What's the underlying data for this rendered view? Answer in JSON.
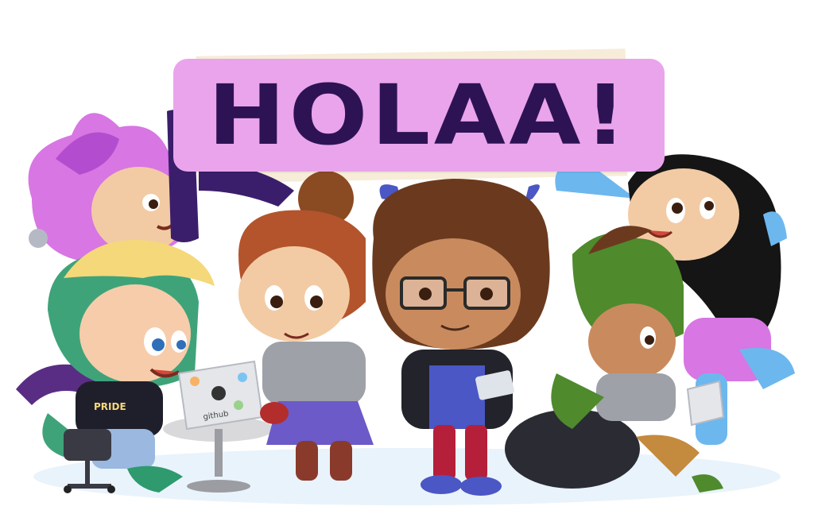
{
  "banner": {
    "text": "HOLAA!",
    "background_color": "#eaa4ec",
    "text_color": "#2e1354"
  },
  "laptop_screen_text": "github",
  "shirt_text": "PRIDE",
  "characters": [
    {
      "name": "purple-haired-octocat",
      "hair_color": "#d876e3"
    },
    {
      "name": "blonde-green-octocat",
      "hair_color": "#f5d87a"
    },
    {
      "name": "bun-haired-octocat",
      "hair_color": "#8a4a22"
    },
    {
      "name": "curly-haired-glasses-octocat",
      "hair_color": "#6b3a1e"
    },
    {
      "name": "green-hat-octocat",
      "hair_color": "#4f8a2d"
    },
    {
      "name": "black-haired-blue-octocat",
      "hair_color": "#151515"
    }
  ]
}
